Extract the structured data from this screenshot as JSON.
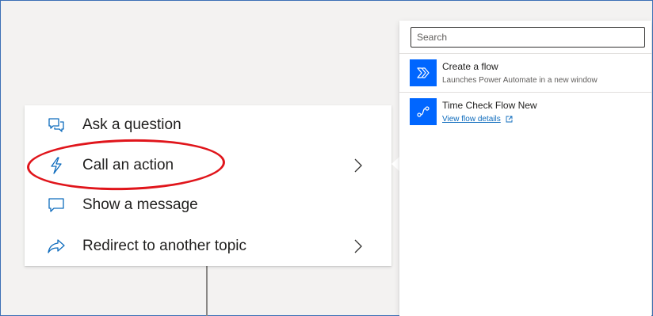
{
  "menu": {
    "items": [
      {
        "label": "Ask a question",
        "icon": "chat-question-icon",
        "has_submenu": false
      },
      {
        "label": "Call an action",
        "icon": "lightning-icon",
        "has_submenu": true
      },
      {
        "label": "Show a message",
        "icon": "message-icon",
        "has_submenu": false
      },
      {
        "label": "Redirect to another topic",
        "icon": "share-arrow-icon",
        "has_submenu": true
      }
    ]
  },
  "panel": {
    "search_placeholder": "Search",
    "items": [
      {
        "title": "Create a flow",
        "subtitle": "Launches Power Automate in a new window",
        "icon": "power-automate-icon"
      },
      {
        "title": "Time Check Flow New",
        "link_text": "View flow details",
        "icon": "flow-icon"
      }
    ]
  },
  "colors": {
    "accent": "#0066ff",
    "annotation": "#e0151b",
    "icon_stroke": "#0f6cbd",
    "link": "#0f6cbd"
  }
}
